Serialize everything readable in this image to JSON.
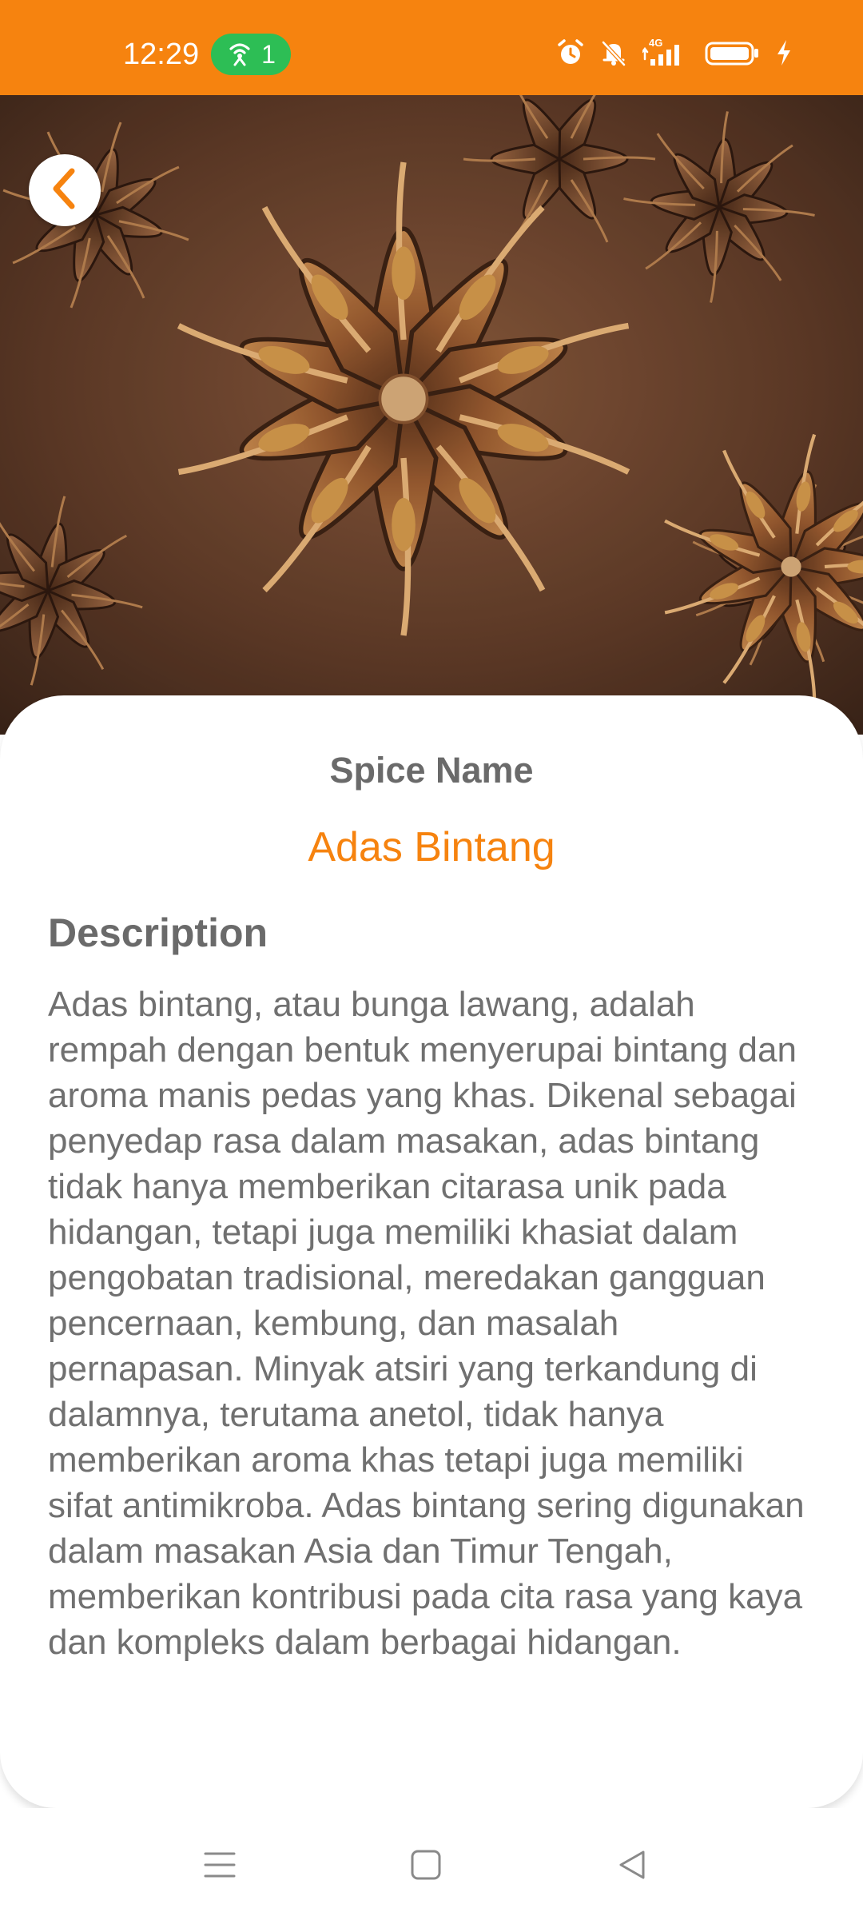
{
  "status_bar": {
    "time": "12:29",
    "hotspot_count": "1",
    "background": "#F6830F",
    "hotspot_color": "#2DBE55",
    "icons": [
      "hotspot-icon",
      "alarm-icon",
      "mute-icon",
      "signal-4g-icon",
      "battery-icon",
      "charging-icon"
    ]
  },
  "hero": {
    "image_subject": "star anise",
    "back_icon": "chevron-left-icon"
  },
  "detail": {
    "name_label": "Spice Name",
    "name_value": "Adas Bintang",
    "description_label": "Description",
    "description_text": "Adas bintang, atau bunga lawang, adalah rempah dengan bentuk menyerupai bintang dan aroma manis pedas yang khas. Dikenal sebagai penyedap rasa dalam masakan, adas bintang tidak hanya memberikan citarasa unik pada hidangan, tetapi juga memiliki khasiat dalam pengobatan tradisional, meredakan gangguan pencernaan, kembung, dan masalah pernapasan. Minyak atsiri yang terkandung di dalamnya, terutama anetol, tidak hanya memberikan aroma khas tetapi juga memiliki sifat antimikroba. Adas bintang sering digunakan dalam masakan Asia dan Timur Tengah, memberikan kontribusi pada cita rasa yang kaya dan kompleks dalam berbagai hidangan."
  },
  "colors": {
    "accent": "#F6830F",
    "label_gray": "#6a6a6a",
    "text_gray": "#707070"
  },
  "nav_bar": {
    "icons": [
      "menu-icon",
      "home-square-icon",
      "back-triangle-icon"
    ]
  }
}
